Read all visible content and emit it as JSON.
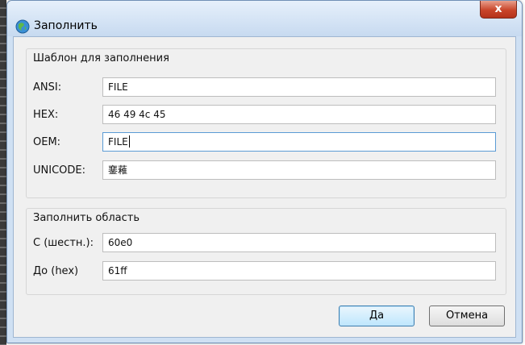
{
  "window": {
    "title": "Заполнить",
    "close_glyph": "x"
  },
  "template_group": {
    "title": "Шаблон для заполнения",
    "fields": [
      {
        "label": "ANSI:",
        "value": "FILE"
      },
      {
        "label": "HEX:",
        "value": "46 49 4c 45"
      },
      {
        "label": "OEM:",
        "value": "FILE"
      },
      {
        "label": "UNICODE:",
        "value": "䥆䕌"
      }
    ]
  },
  "range_group": {
    "title": "Заполнить область",
    "fields": [
      {
        "label": "С (шестн.):",
        "value": "60e0"
      },
      {
        "label": "До (hex)",
        "value": "61ff"
      }
    ]
  },
  "buttons": {
    "ok": "Да",
    "cancel": "Отмена"
  },
  "icons": {
    "app": "app-globe-icon",
    "close": "close-icon"
  },
  "colors": {
    "titlebar": "#c7daf0",
    "close": "#c9452a",
    "default_button_border": "#3c7fb1",
    "focus_border": "#5b9bd5"
  }
}
